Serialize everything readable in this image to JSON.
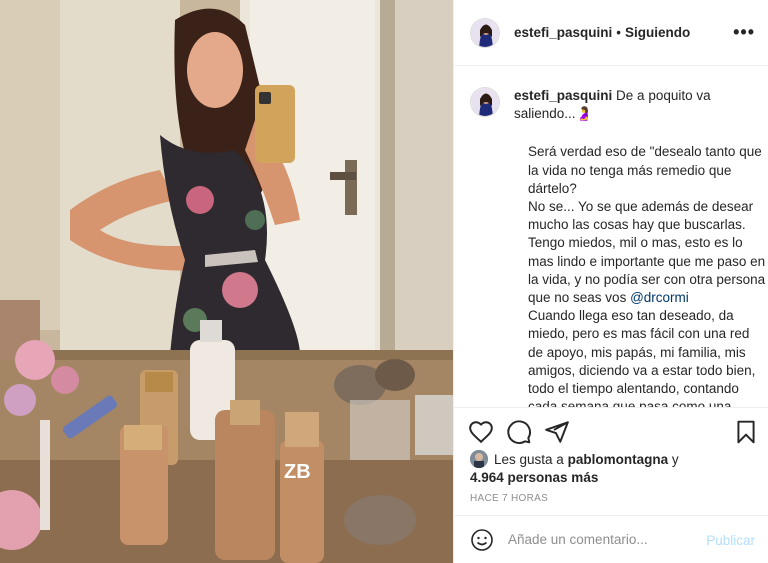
{
  "post": {
    "username": "estefi_pasquini",
    "dot": "•",
    "follow_status": "Siguiendo",
    "more_icon": "more-icon"
  },
  "caption": {
    "username": "estefi_pasquini",
    "headline": "De a poquito va saliendo...",
    "headline_emoji": "🤰",
    "line_1": "Será verdad eso de \"desealo tanto que la vida no tenga más remedio que dártelo?",
    "line_2_before_mention": "No se... Yo se que además de desear mucho las cosas hay que buscarlas. Tengo miedos, mil o mas, esto es lo mas lindo e importante que me paso en la vida, y no podía ser con otra persona que no seas vos",
    "mention": "@drcormi",
    "line_3": "Cuando llega eso tan deseado, da miedo, pero es mas fácil con una red de apoyo, mis papás, mi familia, mis amigos, diciendo va a estar todo bien, todo el tiempo alentando, contando cada semana que pasa como una victoria. Compartiendo anécdotas que"
  },
  "actions": {
    "like_icon": "heart-icon",
    "comment_icon": "comment-icon",
    "share_icon": "share-icon",
    "save_icon": "bookmark-icon"
  },
  "likes": {
    "prefix": "Les gusta a",
    "user": "pablomontagna",
    "connector": "y",
    "count": "4.964 personas más"
  },
  "timestamp": "HACE 7 HORAS",
  "comment_box": {
    "placeholder": "Añade un comentario...",
    "publish_label": "Publicar",
    "emoji_icon": "smiley-icon"
  },
  "colors": {
    "link": "#00376b",
    "publish_disabled": "#b2dffc",
    "muted": "#8e8e8e",
    "text": "#262626"
  }
}
